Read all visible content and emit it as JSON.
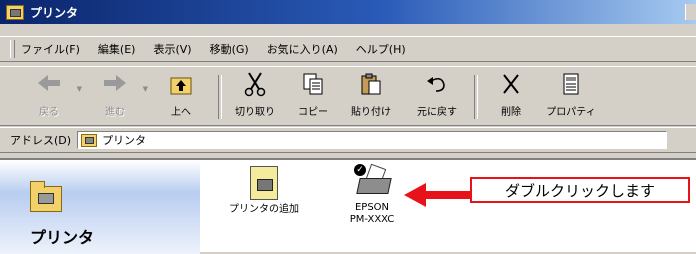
{
  "window": {
    "title": "プリンタ"
  },
  "menu": {
    "items": [
      "ファイル(F)",
      "編集(E)",
      "表示(V)",
      "移動(G)",
      "お気に入り(A)",
      "ヘルプ(H)"
    ]
  },
  "toolbar": {
    "back": "戻る",
    "forward": "進む",
    "up": "上へ",
    "cut": "切り取り",
    "copy": "コピー",
    "paste": "貼り付け",
    "undo": "元に戻す",
    "delete": "削除",
    "properties": "プロパティ"
  },
  "address": {
    "label": "アドレス(D)",
    "value": "プリンタ"
  },
  "content": {
    "folder_title": "プリンタ",
    "items": [
      {
        "label": "プリンタの追加",
        "icon": "add-printer-icon"
      },
      {
        "label_line1": "EPSON",
        "label_line2": "PM-XXXC",
        "icon": "printer-icon"
      }
    ]
  },
  "callout": {
    "text": "ダブルクリックします",
    "color": "#e8131a"
  }
}
